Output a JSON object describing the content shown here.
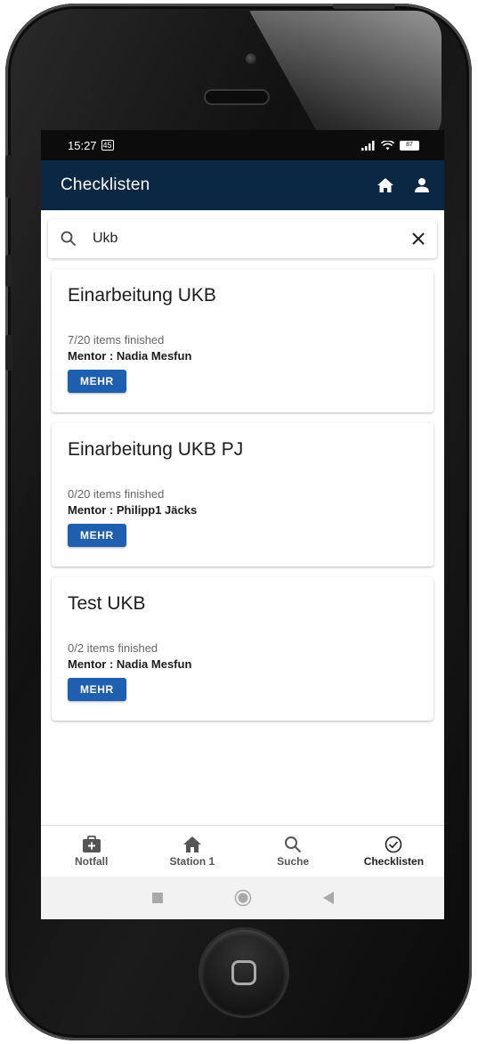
{
  "status": {
    "time": "15:27",
    "notification_badge": "45",
    "battery": "87"
  },
  "appbar": {
    "title": "Checklisten"
  },
  "search": {
    "value": "Ukb",
    "clear_icon": "close-icon",
    "search_icon": "search-icon"
  },
  "cards": [
    {
      "title": "Einarbeitung UKB",
      "progress": "7/20 items finished",
      "mentor": "Mentor : Nadia Mesfun",
      "button": "MEHR"
    },
    {
      "title": "Einarbeitung UKB PJ",
      "progress": "0/20 items finished",
      "mentor": "Mentor : Philipp1 Jäcks",
      "button": "MEHR"
    },
    {
      "title": "Test UKB",
      "progress": "0/2 items finished",
      "mentor": "Mentor : Nadia Mesfun",
      "button": "MEHR"
    }
  ],
  "bottom_nav": [
    {
      "label": "Notfall",
      "icon": "medical-bag-icon"
    },
    {
      "label": "Station 1",
      "icon": "home-icon"
    },
    {
      "label": "Suche",
      "icon": "search-icon"
    },
    {
      "label": "Checklisten",
      "icon": "check-circle-icon",
      "active": true
    }
  ],
  "colors": {
    "appbar": "#0a2744",
    "button": "#1e5fb0"
  }
}
